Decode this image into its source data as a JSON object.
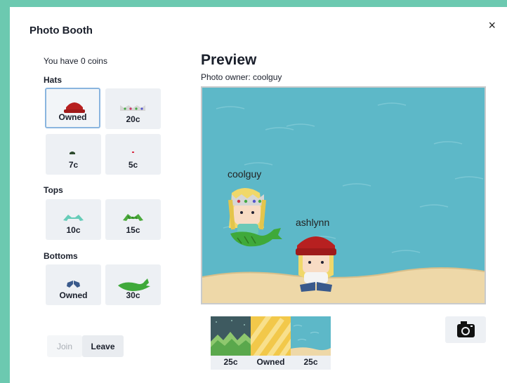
{
  "dialog": {
    "title": "Photo Booth",
    "close_label": "×"
  },
  "coins_text": "You have 0 coins",
  "sections": {
    "hats": "Hats",
    "tops": "Tops",
    "bottoms": "Bottoms"
  },
  "hats": [
    {
      "label": "Owned",
      "icon": "red-beanie-icon",
      "selected": true
    },
    {
      "label": "20c",
      "icon": "crown-icon"
    },
    {
      "label": "7c",
      "icon": "small-hat-icon"
    },
    {
      "label": "5c",
      "icon": "tiny-dot-hat-icon"
    }
  ],
  "tops": [
    {
      "label": "10c",
      "icon": "teal-top-icon"
    },
    {
      "label": "15c",
      "icon": "green-top-icon"
    }
  ],
  "bottoms": [
    {
      "label": "Owned",
      "icon": "blue-shorts-icon"
    },
    {
      "label": "30c",
      "icon": "mermaid-tail-icon"
    }
  ],
  "buttons": {
    "join": "Join",
    "leave": "Leave"
  },
  "preview": {
    "title": "Preview",
    "owner_text": "Photo owner: coolguy",
    "players": [
      {
        "name": "coolguy"
      },
      {
        "name": "ashlynn"
      }
    ]
  },
  "backgrounds": [
    {
      "label": "25c",
      "icon": "mountains-bg-icon"
    },
    {
      "label": "Owned",
      "icon": "yellow-stripes-bg-icon"
    },
    {
      "label": "25c",
      "icon": "beach-bg-icon"
    }
  ],
  "camera_icon": "camera-icon",
  "colors": {
    "frame": "#6cc9b0",
    "tile": "#edf0f4",
    "selected_border": "#8ab5df",
    "water": "#5db8c8",
    "sand": "#eed8a8"
  }
}
